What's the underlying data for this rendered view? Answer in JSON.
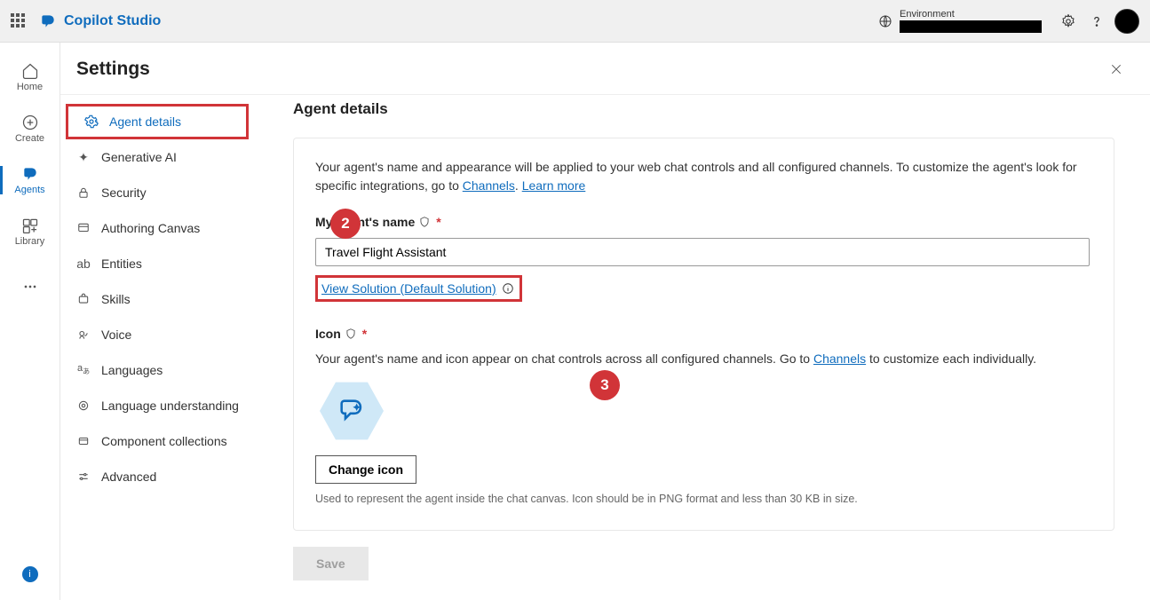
{
  "brand": {
    "name": "Copilot Studio"
  },
  "env": {
    "label": "Environment",
    "value": "████████"
  },
  "leftnav": {
    "home": "Home",
    "create": "Create",
    "agents": "Agents",
    "library": "Library"
  },
  "page": {
    "title": "Settings"
  },
  "settings_nav": {
    "agent_details": "Agent details",
    "generative_ai": "Generative AI",
    "security": "Security",
    "authoring_canvas": "Authoring Canvas",
    "entities": "Entities",
    "skills": "Skills",
    "voice": "Voice",
    "languages": "Languages",
    "language_understanding": "Language understanding",
    "component_collections": "Component collections",
    "advanced": "Advanced"
  },
  "details": {
    "heading": "Agent details",
    "desc_pre": "Your agent's name and appearance will be applied to your web chat controls and all configured channels. To customize the agent's look for specific integrations, go to ",
    "channels_link": "Channels",
    "learn_more": "Learn more",
    "name_label": "My agent's name",
    "name_value": "Travel Flight Assistant",
    "view_solution": "View Solution (Default Solution)",
    "icon_label": "Icon",
    "icon_desc_pre": "Your agent's name and icon appear on chat controls across all configured channels. Go to ",
    "icon_desc_post": " to customize each individually.",
    "change_icon": "Change icon",
    "icon_hint": "Used to represent the agent inside the chat canvas. Icon should be in PNG format and less than 30 KB in size.",
    "save": "Save"
  },
  "annotations": {
    "two": "2",
    "three": "3"
  }
}
